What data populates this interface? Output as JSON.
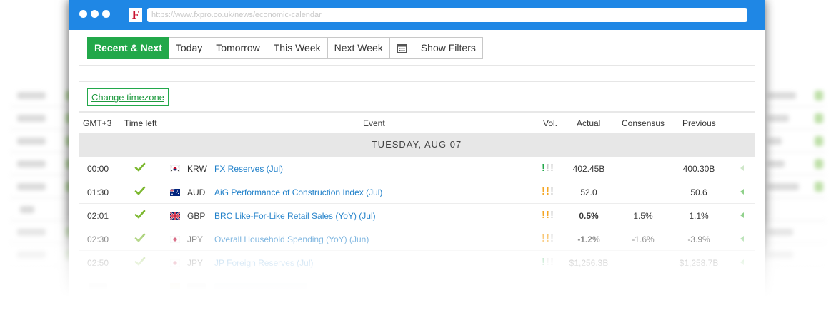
{
  "browser": {
    "url": "https://www.fxpro.co.uk/news/economic-calendar",
    "favicon_letter": "F",
    "titlebar_color": "#1f87e5"
  },
  "filters": {
    "tabs": [
      {
        "label": "Recent & Next",
        "active": true
      },
      {
        "label": "Today"
      },
      {
        "label": "Tomorrow"
      },
      {
        "label": "This Week"
      },
      {
        "label": "Next Week"
      },
      {
        "label": "",
        "icon": "calendar-icon"
      },
      {
        "label": "Show Filters"
      }
    ],
    "accent": "#22a84a"
  },
  "timezone_button": "Change timezone",
  "table": {
    "headers": {
      "timezone": "GMT+3",
      "time_left": "Time left",
      "event": "Event",
      "vol": "Vol.",
      "actual": "Actual",
      "consensus": "Consensus",
      "previous": "Previous"
    },
    "day": "TUESDAY, AUG 07",
    "rows": [
      {
        "time": "00:00",
        "status": "check-icon",
        "flag": "south-korea-flag-icon",
        "currency": "KRW",
        "event": "FX Reserves (Jul)",
        "volatility": 1,
        "actual": "402.45B",
        "consensus": "",
        "previous": "400.30B"
      },
      {
        "time": "01:30",
        "status": "check-icon",
        "flag": "australia-flag-icon",
        "currency": "AUD",
        "event": "AiG Performance of Construction Index (Jul)",
        "volatility": 2,
        "actual": "52.0",
        "consensus": "",
        "previous": "50.6"
      },
      {
        "time": "02:01",
        "status": "check-icon",
        "flag": "uk-flag-icon",
        "currency": "GBP",
        "event": "BRC Like-For-Like Retail Sales (YoY) (Jul)",
        "volatility": 2,
        "actual": "0.5%",
        "consensus": "1.5%",
        "previous": "1.1%"
      },
      {
        "time": "02:30",
        "status": "check-icon",
        "flag": "japan-flag-icon",
        "currency": "JPY",
        "event": "Overall Household Spending (YoY) (Jun)",
        "volatility": 2,
        "actual": "-1.2%",
        "consensus": "-1.6%",
        "previous": "-3.9%"
      },
      {
        "time": "02:50",
        "status": "check-icon",
        "flag": "japan-flag-icon",
        "currency": "JPY",
        "event": "JP Foreign Reserves (Jul)",
        "volatility": 1,
        "actual": "$1,256.3B",
        "consensus": "",
        "previous": "$1,258.7B"
      }
    ]
  }
}
